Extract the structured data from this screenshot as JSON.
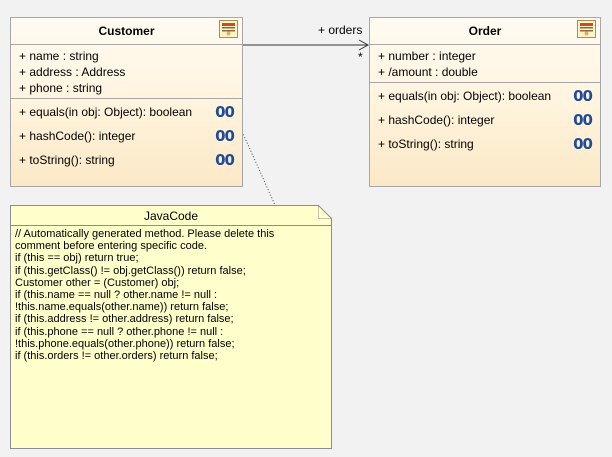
{
  "classes": {
    "customer": {
      "name": "Customer",
      "icon": "class-icon",
      "attributes": [
        "+ name : string",
        "+ address : Address",
        "+ phone : string"
      ],
      "operations": [
        {
          "label": "+ equals(in obj: Object): boolean",
          "glyph": "00"
        },
        {
          "label": "+ hashCode(): integer",
          "glyph": "00"
        },
        {
          "label": "+ toString(): string",
          "glyph": "00"
        }
      ]
    },
    "order": {
      "name": "Order",
      "icon": "class-icon",
      "attributes": [
        "+ number : integer",
        "+ /amount : double"
      ],
      "operations": [
        {
          "label": "+ equals(in obj: Object): boolean",
          "glyph": "00"
        },
        {
          "label": "+ hashCode(): integer",
          "glyph": "00"
        },
        {
          "label": "+ toString(): string",
          "glyph": "00"
        }
      ]
    }
  },
  "association": {
    "role": "+ orders",
    "multiplicity": "*"
  },
  "note": {
    "title": "JavaCode",
    "lines": [
      "// Automatically generated method. Please delete this",
      "comment before entering specific code.",
      "if (this == obj) return true;",
      "if (this.getClass() != obj.getClass()) return false;",
      "Customer other = (Customer) obj;",
      "if (this.name == null ? other.name != null :",
      "  !this.name.equals(other.name)) return false;",
      "if (this.address != other.address) return false;",
      "if (this.phone == null ? other.phone != null :",
      "  !this.phone.equals(other.phone)) return false;",
      "if (this.orders != other.orders) return false;"
    ]
  },
  "colors": {
    "border": "#a7a7a7",
    "note_fill": "#ffffcc",
    "op_glyph": "#1f4b9b"
  }
}
